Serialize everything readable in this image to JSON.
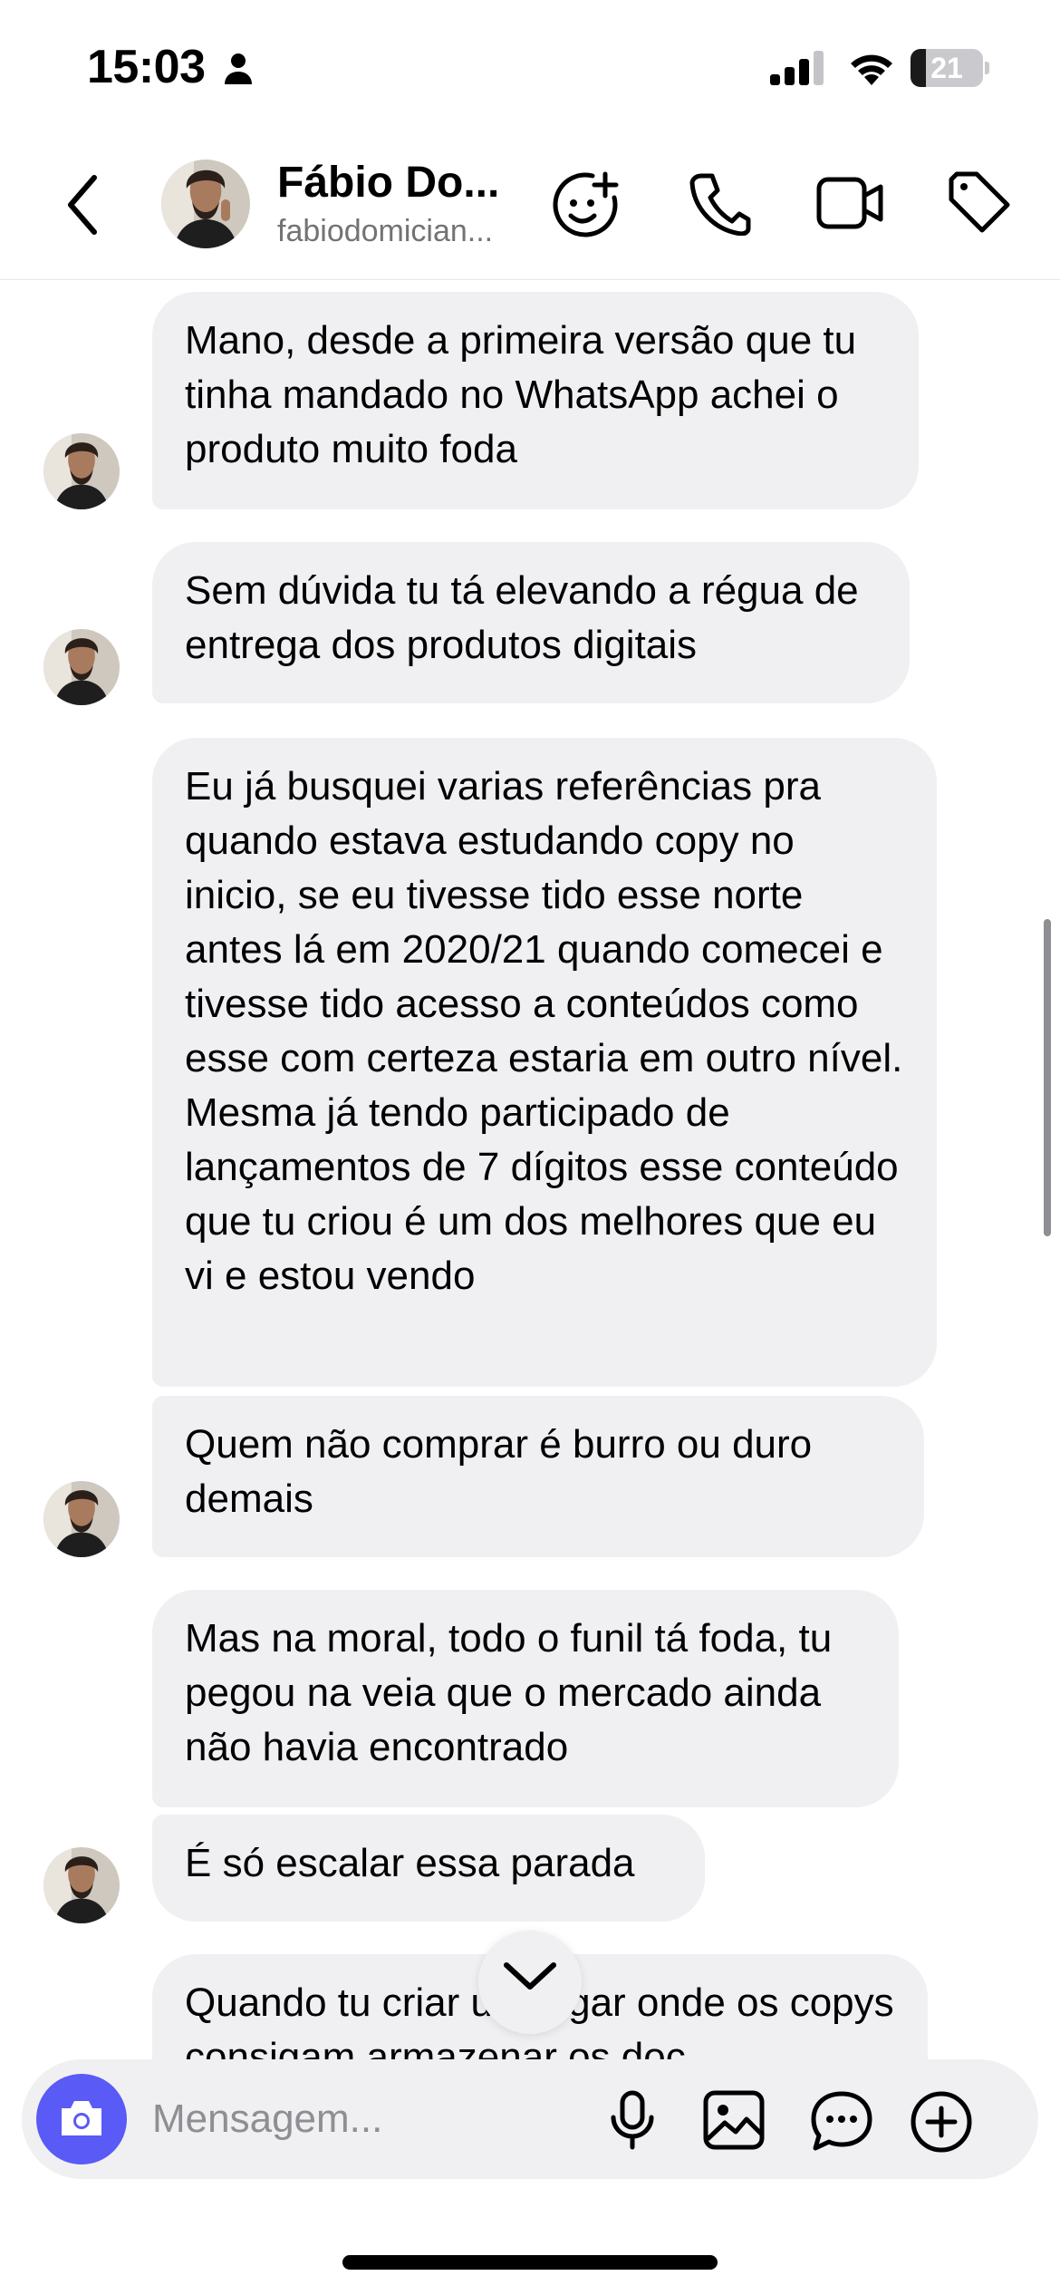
{
  "status_bar": {
    "time": "15:03",
    "battery_level": "21",
    "battery_fraction": 0.21,
    "person_icon": "person-icon",
    "signal_icon": "cellular-signal-icon",
    "wifi_icon": "wifi-icon"
  },
  "header": {
    "name": "Fábio Do...",
    "username": "fabiodomician...",
    "icons": [
      "back-chevron-icon",
      "add-sticker-face-icon",
      "phone-icon",
      "video-camera-icon",
      "tag-icon"
    ]
  },
  "messages": [
    {
      "text": "Mano, desde a primeira versão que tu tinha mandado no WhatsApp achei o produto muito foda"
    },
    {
      "text": "Sem dúvida tu tá elevando a régua de entrega dos produtos digitais"
    },
    {
      "text": "Eu já busquei varias referências pra quando estava estudando copy no inicio, se eu tivesse tido esse norte antes lá em 2020/21 quando comecei e tivesse tido acesso a conteúdos como esse com certeza estaria em outro nível. Mesma já tendo participado de lançamentos de 7 dígitos esse conteúdo que tu criou é um dos melhores que eu vi e estou vendo"
    },
    {
      "text": "Quem não comprar é burro ou duro demais"
    },
    {
      "text": "Mas na moral, todo o funil tá foda, tu pegou na veia que o mercado ainda não havia encontrado"
    },
    {
      "text": "É só escalar essa parada"
    },
    {
      "text": "Quando tu criar um lugar onde os copys consigam armazenar os doc"
    }
  ],
  "composer": {
    "placeholder": "Mensagem...",
    "icons": [
      "camera-icon",
      "microphone-icon",
      "gallery-icon",
      "chat-bubble-icon",
      "add-circle-icon"
    ]
  },
  "colors": {
    "bubble": "#f0f0f2",
    "camera_button": "#5a5af6",
    "secondary_text": "#737373"
  }
}
